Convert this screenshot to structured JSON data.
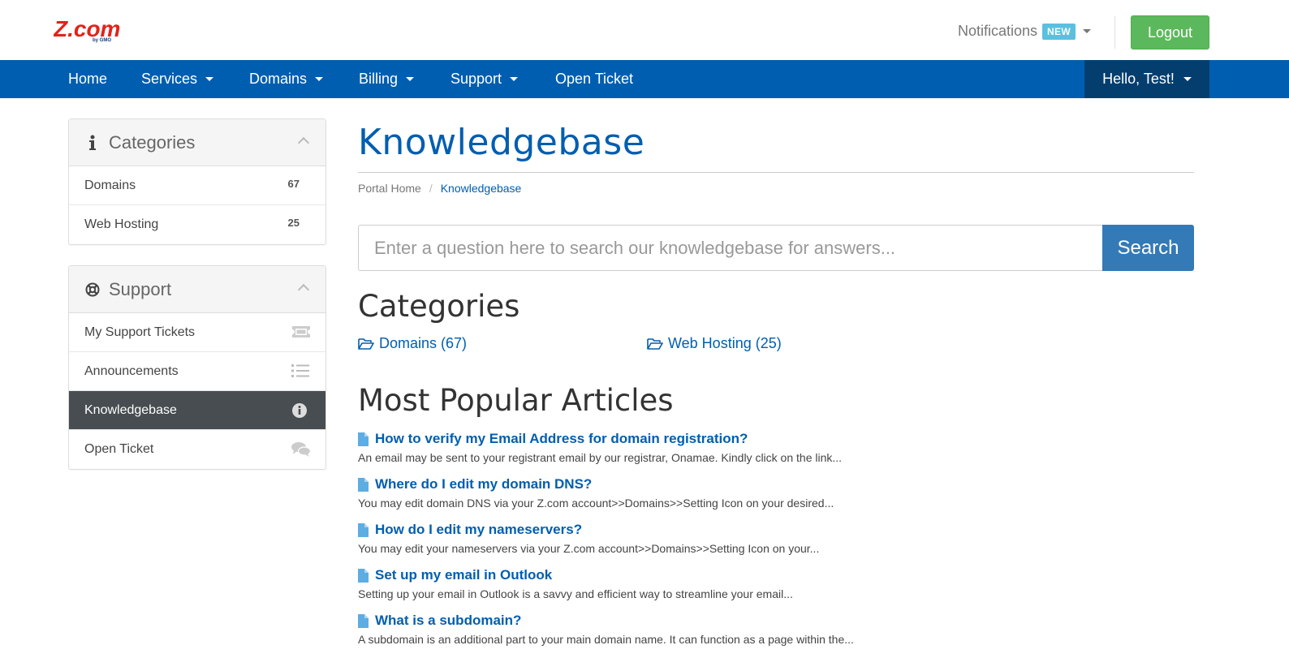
{
  "header": {
    "logo_text": "Z.com",
    "logo_sub": "by GMO",
    "notifications_label": "Notifications",
    "notifications_badge": "NEW",
    "logout_label": "Logout"
  },
  "nav": {
    "items": [
      {
        "label": "Home"
      },
      {
        "label": "Services"
      },
      {
        "label": "Domains"
      },
      {
        "label": "Billing"
      },
      {
        "label": "Support"
      },
      {
        "label": "Open Ticket"
      }
    ],
    "user_label": "Hello, Test!"
  },
  "sidebar": {
    "categories": {
      "title": "Categories",
      "items": [
        {
          "label": "Domains",
          "count": "67"
        },
        {
          "label": "Web Hosting",
          "count": "25"
        }
      ]
    },
    "support": {
      "title": "Support",
      "items": [
        {
          "label": "My Support Tickets",
          "icon": "ticket-icon"
        },
        {
          "label": "Announcements",
          "icon": "list-icon"
        },
        {
          "label": "Knowledgebase",
          "icon": "info-icon",
          "active": true
        },
        {
          "label": "Open Ticket",
          "icon": "comments-icon"
        }
      ]
    }
  },
  "main": {
    "title": "Knowledgebase",
    "breadcrumb": [
      "Portal Home",
      "Knowledgebase"
    ],
    "search_placeholder": "Enter a question here to search our knowledgebase for answers...",
    "search_button": "Search",
    "categories_heading": "Categories",
    "categories": [
      {
        "label": "Domains (67)"
      },
      {
        "label": "Web Hosting (25)"
      }
    ],
    "popular_heading": "Most Popular Articles",
    "articles": [
      {
        "title": "How to verify my Email Address for domain registration?",
        "desc": "An email may be sent to your registrant email by our registrar, Onamae. Kindly click on the link..."
      },
      {
        "title": "Where do I edit my domain DNS?",
        "desc": "You may edit domain DNS via your Z.com account>>Domains>>Setting Icon on your desired..."
      },
      {
        "title": "How do I edit my nameservers?",
        "desc": "You may edit your nameservers via your Z.com account>>Domains>>Setting Icon on your..."
      },
      {
        "title": "Set up my email in Outlook",
        "desc": "Setting up your email in Outlook is a savvy and efficient way to streamline your email..."
      },
      {
        "title": "What is a subdomain?",
        "desc": "A subdomain is an additional part to your main domain name. It can function as a page within the..."
      }
    ]
  },
  "colors": {
    "brand_red": "#e2231a",
    "nav_blue": "#005eb0",
    "nav_user_bg": "#033e6e",
    "logout_green": "#5cb85c",
    "search_button": "#337ab7",
    "badge_blue": "#5bc0de",
    "active_row": "#474d51"
  }
}
